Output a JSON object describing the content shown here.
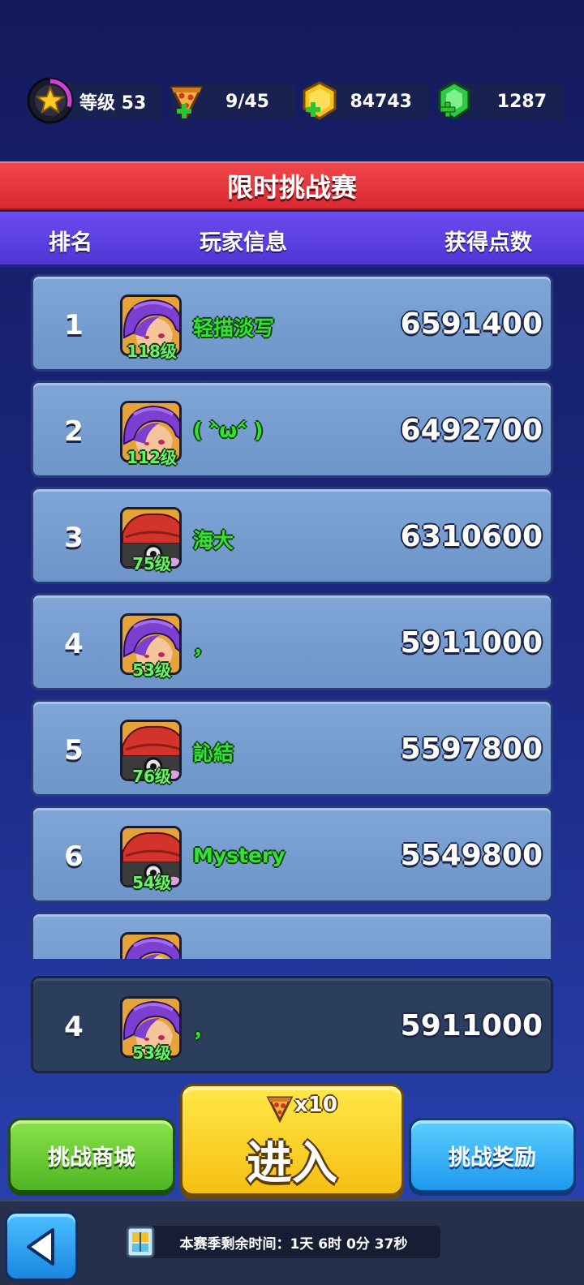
{
  "topbar": {
    "level_label": "等级 53",
    "level_progress": 0.3,
    "stamina": "9/45",
    "gold": "84743",
    "gems": "1287"
  },
  "title": "限时挑战赛",
  "headers": {
    "rank": "排名",
    "player": "玩家信息",
    "points": "获得点数"
  },
  "rows": [
    {
      "rank": "1",
      "avatar": "purple-hair-hero",
      "level": "118级",
      "name": "轻描淡写",
      "score": "6591400"
    },
    {
      "rank": "2",
      "avatar": "purple-hair-hero",
      "level": "112级",
      "name": "( ᵔ̀ѡᵔ́ )",
      "score": "6492700"
    },
    {
      "rank": "3",
      "avatar": "red-hat-hero",
      "level": "75级",
      "name": "海大",
      "score": "6310600"
    },
    {
      "rank": "4",
      "avatar": "purple-hair-hero",
      "level": "53级",
      "name": "，",
      "score": "5911000"
    },
    {
      "rank": "5",
      "avatar": "red-hat-hero",
      "level": "76级",
      "name": "訫結",
      "score": "5597800"
    },
    {
      "rank": "6",
      "avatar": "red-hat-hero",
      "level": "54级",
      "name": "Mystery",
      "score": "5549800"
    }
  ],
  "my_row": {
    "rank": "4",
    "avatar": "purple-hair-hero",
    "level": "53级",
    "name": "，",
    "score": "5911000"
  },
  "buttons": {
    "shop": "挑战商城",
    "enter": "进入",
    "enter_cost": "x10",
    "reward": "挑战奖励"
  },
  "timer": "本赛季剩余时间：1天 6时 0分 37秒",
  "colors": {
    "title_red": "#e3343b",
    "header_purple": "#5d40e0",
    "name_green": "#34e234",
    "level_green": "#6af06a"
  }
}
